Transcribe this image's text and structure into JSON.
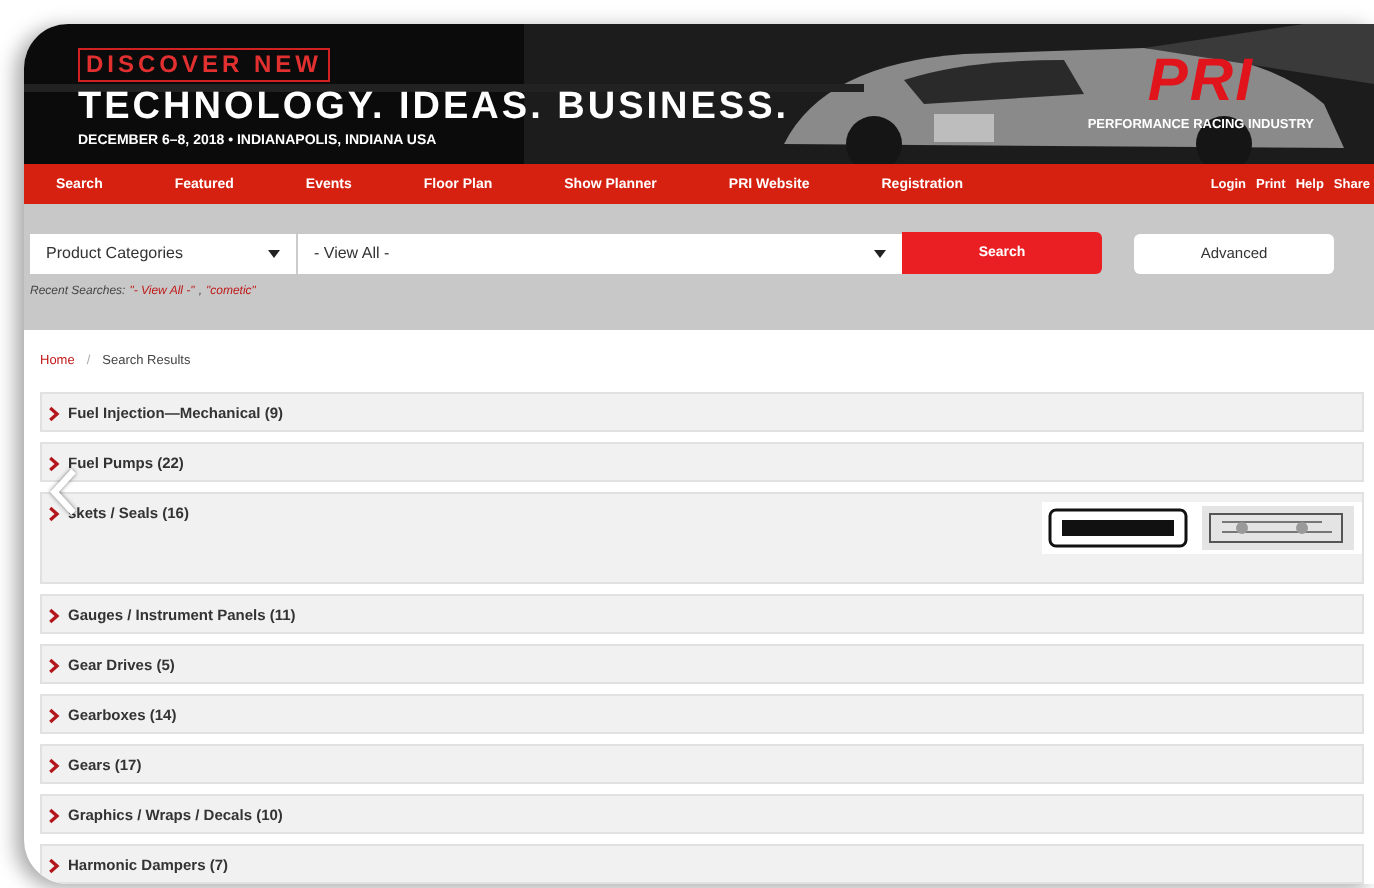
{
  "banner": {
    "tag": "DISCOVER NEW",
    "headline": "TECHNOLOGY. IDEAS. BUSINESS.",
    "dateline": "DECEMBER 6–8, 2018 • INDIANAPOLIS, INDIANA USA",
    "logo": "PRI",
    "logo_caption": "PERFORMANCE RACING INDUSTRY"
  },
  "nav": {
    "items": [
      "Search",
      "Featured",
      "Events",
      "Floor Plan",
      "Show Planner",
      "PRI Website",
      "Registration"
    ],
    "links": [
      "Login",
      "Print",
      "Help",
      "Share"
    ]
  },
  "search": {
    "category": "Product Categories",
    "scope": "- View All -",
    "button": "Search",
    "advanced": "Advanced",
    "recent": {
      "label": "Recent Searches:",
      "links": [
        "\"- View All -\"",
        "\"cometic\""
      ],
      "separator": ","
    }
  },
  "breadcrumb": {
    "items": [
      {
        "label": "Home",
        "kind": "link"
      },
      {
        "label": "Search Results",
        "kind": "current"
      }
    ],
    "separator": "/"
  },
  "categories": [
    {
      "label": "Fuel Injection—Mechanical (9)"
    },
    {
      "label": "Fuel Pumps (22)"
    },
    {
      "label": "skets / Seals (16)"
    },
    {
      "label": "Gauges / Instrument Panels (11)"
    },
    {
      "label": "Gear Drives (5)"
    },
    {
      "label": "Gearboxes (14)"
    },
    {
      "label": "Gears (17)"
    },
    {
      "label": "Graphics / Wraps / Decals (10)"
    },
    {
      "label": "Harmonic Dampers (7)"
    }
  ]
}
